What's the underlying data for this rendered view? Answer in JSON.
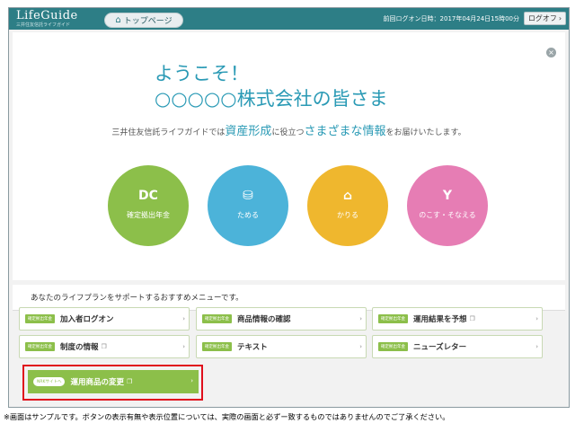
{
  "header": {
    "logo": "LifeGuide",
    "logo_sub": "三井住友信託ライフガイド",
    "home_tab": "トップページ",
    "home_icon": "home-icon",
    "last_login": "前回ログオン日時：2017年04月24日15時00分",
    "logout": "ログオフ",
    "logout_arrow": "›"
  },
  "panel": {
    "close": "×",
    "welcome": "ようこそ！",
    "company": "○○○○○株式会社の皆さま",
    "tagline_pre": "三井住友信託ライフガイドでは",
    "tagline_big1": "資産形成",
    "tagline_mid": "に役立つ",
    "tagline_big2": "さまざまな情報",
    "tagline_post": "をお届けいたします。"
  },
  "categories": [
    {
      "icon": "DC",
      "label": "確定拠出年金",
      "color": "#8cbf4a"
    },
    {
      "icon": "⛁",
      "label": "ためる",
      "color": "#4cb3d9"
    },
    {
      "icon": "⌂",
      "label": "かりる",
      "color": "#efb72e"
    },
    {
      "icon": "Y",
      "label": "のこす・そなえる",
      "color": "#e67db4"
    }
  ],
  "recommend": {
    "title": "あなたのライフプランをサポートするおすすめメニューです。",
    "items": [
      {
        "tag": "確定拠出年金",
        "label": "加入者ログオン",
        "ext": ""
      },
      {
        "tag": "確定拠出年金",
        "label": "商品情報の確認",
        "ext": ""
      },
      {
        "tag": "確定拠出年金",
        "label": "運用結果を予想",
        "ext": "❐"
      },
      {
        "tag": "確定拠出年金",
        "label": "制度の情報",
        "ext": "❐"
      },
      {
        "tag": "確定拠出年金",
        "label": "テキスト",
        "ext": ""
      },
      {
        "tag": "確定拠出年金",
        "label": "ニューズレター",
        "ext": ""
      }
    ],
    "arrow": "›",
    "ops": {
      "tag": "NRKサイトへ",
      "label": "運用商品の変更",
      "ext": "❐"
    }
  },
  "note": "※画面はサンプルです。ボタンの表示有無や表示位置については、実際の画面と必ずー致するものではありませんのでご了承ください。"
}
